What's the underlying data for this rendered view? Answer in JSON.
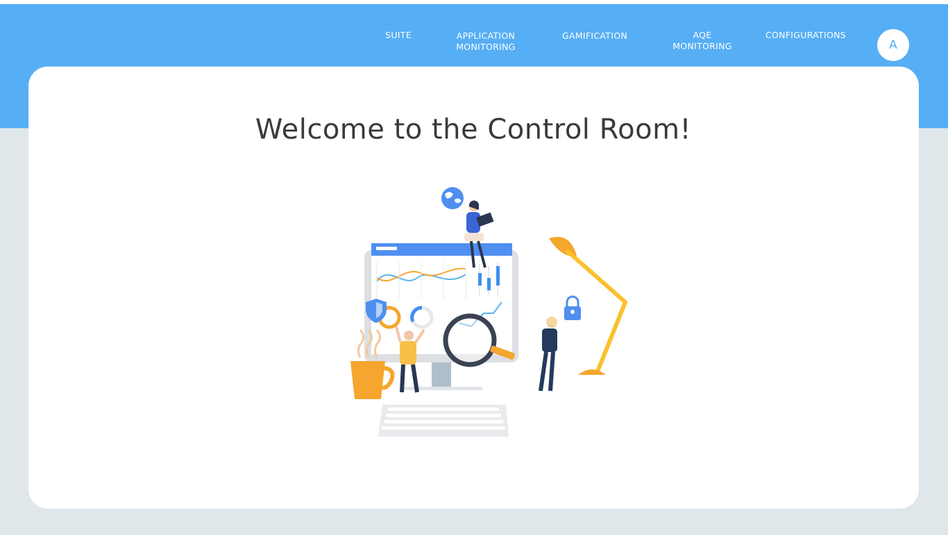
{
  "nav": {
    "items": [
      {
        "label_line1": "SUITE",
        "label_line2": ""
      },
      {
        "label_line1": "APPLICATION",
        "label_line2": "MONITORING"
      },
      {
        "label_line1": "GAMIFICATION",
        "label_line2": ""
      },
      {
        "label_line1": "AQE",
        "label_line2": "MONITORING"
      },
      {
        "label_line1": "CONFIGURATIONS",
        "label_line2": ""
      }
    ],
    "avatar_initial": "A"
  },
  "main": {
    "title": "Welcome to the Control Room!",
    "illustration_icon": "control-room-illustration"
  },
  "colors": {
    "header": "#56aef5",
    "background": "#dfe7eb",
    "card": "#ffffff",
    "title": "#3a3a3a"
  }
}
